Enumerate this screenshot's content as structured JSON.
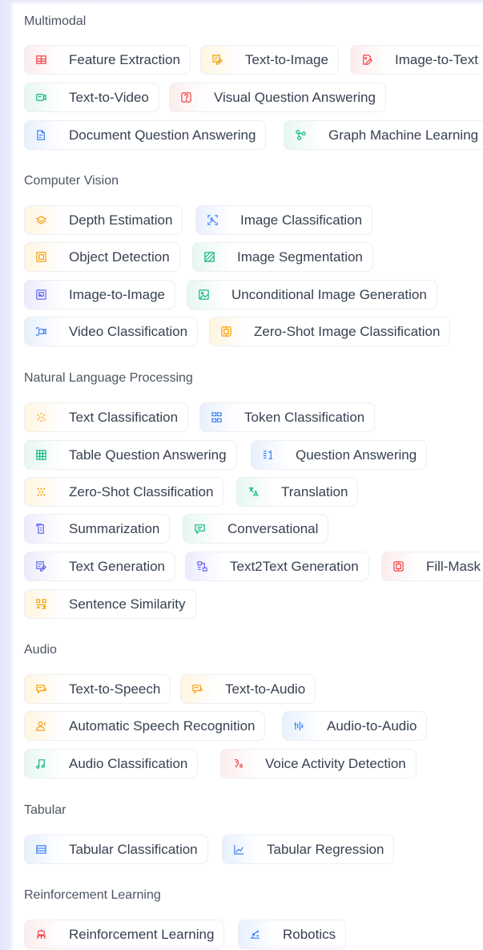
{
  "colors": {
    "red": "#ef4444",
    "amber": "#f59e0b",
    "green": "#10b981",
    "blue": "#3b82f6",
    "indigo": "#6366f1",
    "pink": "#ec4899"
  },
  "sections": [
    {
      "title": "Multimodal",
      "tasks": [
        {
          "label": "Feature Extraction",
          "icon": "table-icon",
          "color": "red"
        },
        {
          "label": "Text-to-Image",
          "icon": "pencil-image-icon",
          "color": "amber"
        },
        {
          "label": "Image-to-Text",
          "icon": "image-pencil-icon",
          "color": "red"
        },
        {
          "label": "Text-to-Video",
          "icon": "video-icon",
          "color": "green"
        },
        {
          "label": "Visual Question Answering",
          "icon": "image-question-icon",
          "color": "red"
        },
        {
          "label": "Document Question Answering",
          "icon": "document-icon",
          "color": "blue"
        },
        {
          "label": "Graph Machine Learning",
          "icon": "graph-icon",
          "color": "green"
        }
      ]
    },
    {
      "title": "Computer Vision",
      "tasks": [
        {
          "label": "Depth Estimation",
          "icon": "layers-icon",
          "color": "amber"
        },
        {
          "label": "Image Classification",
          "icon": "image-tag-icon",
          "color": "blue"
        },
        {
          "label": "Object Detection",
          "icon": "object-box-icon",
          "color": "amber"
        },
        {
          "label": "Image Segmentation",
          "icon": "segment-icon",
          "color": "green"
        },
        {
          "label": "Image-to-Image",
          "icon": "image-stack-icon",
          "color": "indigo"
        },
        {
          "label": "Unconditional Image Generation",
          "icon": "image-frame-icon",
          "color": "green"
        },
        {
          "label": "Video Classification",
          "icon": "video-tag-icon",
          "color": "blue"
        },
        {
          "label": "Zero-Shot Image Classification",
          "icon": "zero-shot-image-icon",
          "color": "amber"
        }
      ]
    },
    {
      "title": "Natural Language Processing",
      "tasks": [
        {
          "label": "Text Classification",
          "icon": "dots-icon",
          "color": "amber"
        },
        {
          "label": "Token Classification",
          "icon": "token-icon",
          "color": "blue"
        },
        {
          "label": "Table Question Answering",
          "icon": "table-grid-icon",
          "color": "green"
        },
        {
          "label": "Question Answering",
          "icon": "question-answer-icon",
          "color": "blue"
        },
        {
          "label": "Zero-Shot Classification",
          "icon": "scatter-icon",
          "color": "amber"
        },
        {
          "label": "Translation",
          "icon": "translate-icon",
          "color": "green"
        },
        {
          "label": "Summarization",
          "icon": "summary-icon",
          "color": "indigo"
        },
        {
          "label": "Conversational",
          "icon": "chat-bubble-icon",
          "color": "green"
        },
        {
          "label": "Text Generation",
          "icon": "text-pencil-icon",
          "color": "indigo"
        },
        {
          "label": "Text2Text Generation",
          "icon": "text-flow-icon",
          "color": "indigo"
        },
        {
          "label": "Fill-Mask",
          "icon": "mask-box-icon",
          "color": "red"
        },
        {
          "label": "Sentence Similarity",
          "icon": "similarity-icon",
          "color": "amber"
        }
      ]
    },
    {
      "title": "Audio",
      "tasks": [
        {
          "label": "Text-to-Speech",
          "icon": "speech-bubble-icon",
          "color": "amber"
        },
        {
          "label": "Text-to-Audio",
          "icon": "speech-bubble-icon",
          "color": "amber"
        },
        {
          "label": "Automatic Speech Recognition",
          "icon": "speaker-person-icon",
          "color": "amber"
        },
        {
          "label": "Audio-to-Audio",
          "icon": "audio-bars-icon",
          "color": "blue"
        },
        {
          "label": "Audio Classification",
          "icon": "music-note-icon",
          "color": "green"
        },
        {
          "label": "Voice Activity Detection",
          "icon": "voice-icon",
          "color": "red"
        }
      ]
    },
    {
      "title": "Tabular",
      "tasks": [
        {
          "label": "Tabular Classification",
          "icon": "table-rows-icon",
          "color": "blue"
        },
        {
          "label": "Tabular Regression",
          "icon": "line-chart-icon",
          "color": "blue"
        }
      ]
    },
    {
      "title": "Reinforcement Learning",
      "tasks": [
        {
          "label": "Reinforcement Learning",
          "icon": "robot-arm-icon",
          "color": "red"
        },
        {
          "label": "Robotics",
          "icon": "robotics-icon",
          "color": "blue"
        }
      ]
    }
  ]
}
